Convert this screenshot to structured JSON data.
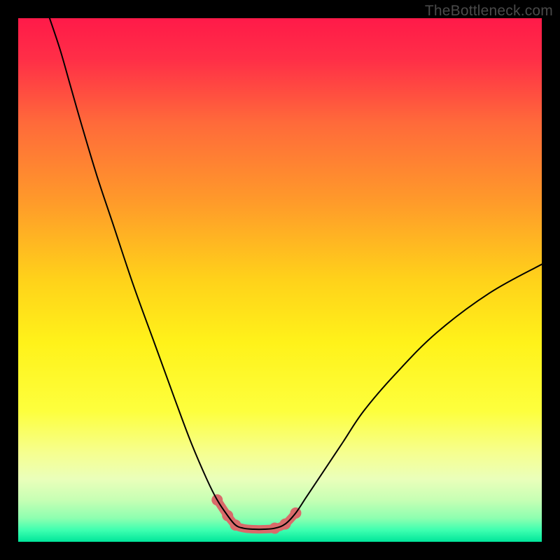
{
  "watermark": "TheBottleneck.com",
  "chart_data": {
    "type": "line",
    "title": "",
    "xlabel": "",
    "ylabel": "",
    "xlim": [
      0,
      100
    ],
    "ylim": [
      0,
      100
    ],
    "grid": false,
    "legend": false,
    "gradient_stops": [
      {
        "offset": 0.0,
        "color": "#ff1a49"
      },
      {
        "offset": 0.08,
        "color": "#ff2f47"
      },
      {
        "offset": 0.2,
        "color": "#ff6a3a"
      },
      {
        "offset": 0.35,
        "color": "#ff9a2a"
      },
      {
        "offset": 0.5,
        "color": "#ffd21a"
      },
      {
        "offset": 0.62,
        "color": "#fff21a"
      },
      {
        "offset": 0.75,
        "color": "#fdff3d"
      },
      {
        "offset": 0.83,
        "color": "#f6ff8f"
      },
      {
        "offset": 0.88,
        "color": "#eaffba"
      },
      {
        "offset": 0.92,
        "color": "#c7ffb4"
      },
      {
        "offset": 0.955,
        "color": "#8dffb0"
      },
      {
        "offset": 0.978,
        "color": "#3dffb0"
      },
      {
        "offset": 1.0,
        "color": "#00e59a"
      }
    ],
    "series": [
      {
        "name": "bottleneck-curve",
        "color": "#000000",
        "width": 2,
        "x": [
          6,
          8,
          10,
          12,
          15,
          18,
          22,
          26,
          30,
          33,
          36,
          38,
          40,
          41.5,
          43,
          45,
          47,
          49,
          51,
          53,
          55,
          58,
          62,
          66,
          72,
          80,
          90,
          100
        ],
        "y": [
          100,
          94,
          87,
          80,
          70,
          61,
          49,
          38,
          27,
          19,
          12,
          8,
          5,
          3.2,
          2.6,
          2.4,
          2.4,
          2.6,
          3.4,
          5.5,
          8.5,
          13,
          19,
          25,
          32,
          40,
          47.5,
          53
        ]
      },
      {
        "name": "highlight-band",
        "color": "#d96a6a",
        "width": 12,
        "linecap": "round",
        "x": [
          38,
          40,
          41.5,
          43,
          45,
          47,
          49,
          51,
          53
        ],
        "y": [
          8,
          5,
          3.2,
          2.6,
          2.4,
          2.4,
          2.6,
          3.4,
          5.5
        ]
      }
    ],
    "highlight_dots": {
      "color": "#d96a6a",
      "radius": 8,
      "x": [
        38,
        40,
        41.5,
        49,
        51,
        53
      ],
      "y": [
        8,
        5,
        3.2,
        2.6,
        3.4,
        5.5
      ]
    }
  }
}
